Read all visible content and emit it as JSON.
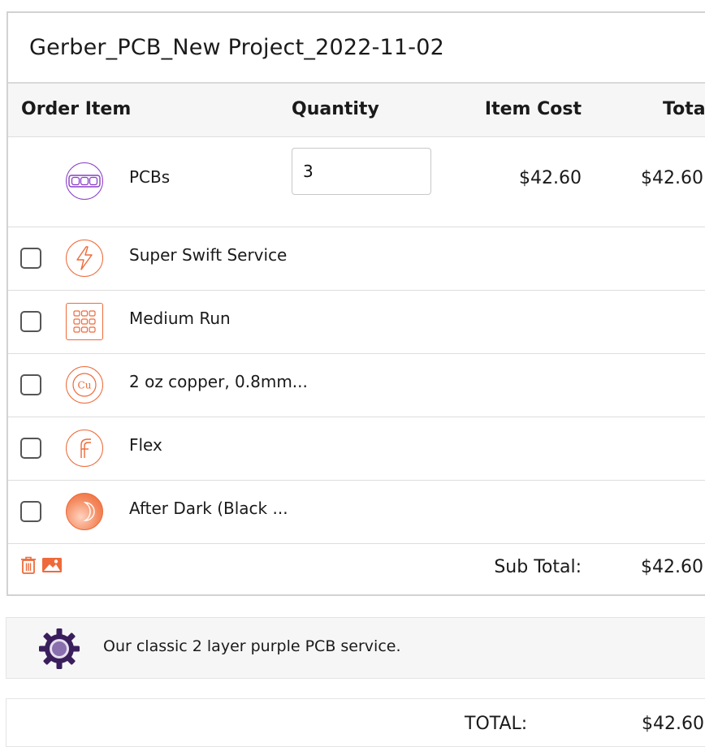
{
  "project": {
    "title": "Gerber_PCB_New Project_2022-11-02"
  },
  "table": {
    "headers": {
      "order_item": "Order Item",
      "quantity": "Quantity",
      "item_cost": "Item Cost",
      "total": "Total"
    }
  },
  "main_item": {
    "icon": "pcb-board-icon",
    "label": "PCBs",
    "quantity": "3",
    "item_cost": "$42.60",
    "total": "$42.60"
  },
  "options": [
    {
      "label": "Super Swift Service",
      "icon": "lightning-icon",
      "checked": false
    },
    {
      "label": "Medium Run",
      "icon": "panel-grid-icon",
      "checked": false
    },
    {
      "label": "2 oz copper, 0.8mm...",
      "icon": "copper-cu-icon",
      "checked": false
    },
    {
      "label": "Flex",
      "icon": "flex-icon",
      "checked": false
    },
    {
      "label": "After Dark (Black ...",
      "icon": "moon-icon",
      "checked": false
    }
  ],
  "footer": {
    "sub_total_label": "Sub Total:",
    "sub_total_value": "$42.60",
    "icons": [
      "trash-icon",
      "image-icon"
    ]
  },
  "description": {
    "icon": "purple-gear-icon",
    "text": "Our classic 2 layer purple PCB service."
  },
  "grand_total": {
    "label": "TOTAL:",
    "value": "$42.60"
  },
  "colors": {
    "accent_orange": "#EE6A3A",
    "accent_purple": "#8A3FC8",
    "border": "#D2D2D2",
    "header_bg": "#F6F6F6"
  }
}
